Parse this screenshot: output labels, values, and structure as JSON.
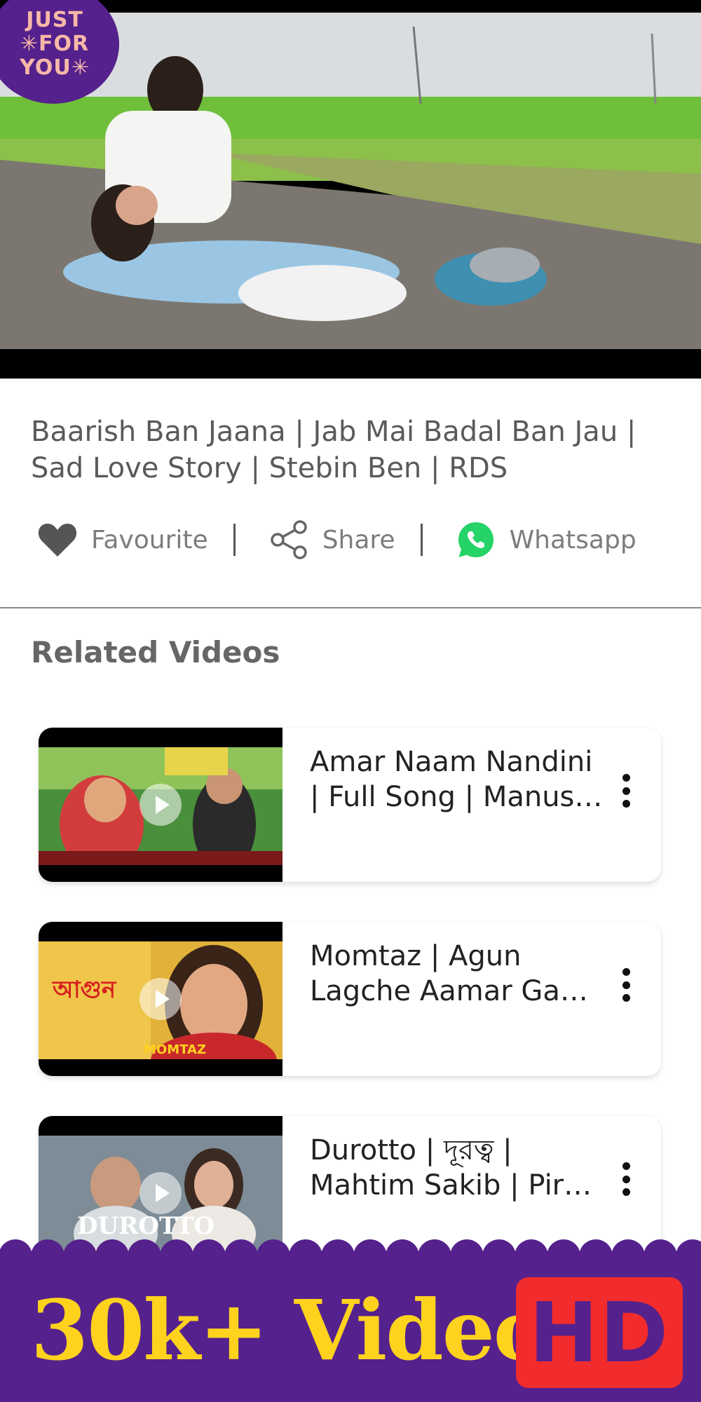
{
  "badge": {
    "line1": "JUST",
    "line2": "✳FOR",
    "line3": "YOU✳"
  },
  "video": {
    "title": "Baarish Ban Jaana | Jab Mai Badal Ban Jau | Sad Love Story | Stebin Ben | RDS"
  },
  "actions": {
    "favourite": {
      "label": "Favourite",
      "icon": "heart-icon"
    },
    "share": {
      "label": "Share",
      "icon": "share-icon"
    },
    "whatsapp": {
      "label": "Whatsapp",
      "icon": "whatsapp-icon",
      "color": "#25d366"
    }
  },
  "related": {
    "title": "Related Videos",
    "items": [
      {
        "title": "Amar Naam Nandini\n| Full Song | Manus…"
      },
      {
        "title": "Momtaz | Agun\nLagche Aamar Ga…"
      },
      {
        "title": "Durotto | দূরত্ব |\nMahtim Sakib | Pir…"
      }
    ]
  },
  "promo": {
    "text": "30k+ Videos",
    "hd": "HD",
    "colors": {
      "background": "#55218c",
      "text": "#ffd21e",
      "hd_box": "#f22c2c"
    }
  }
}
